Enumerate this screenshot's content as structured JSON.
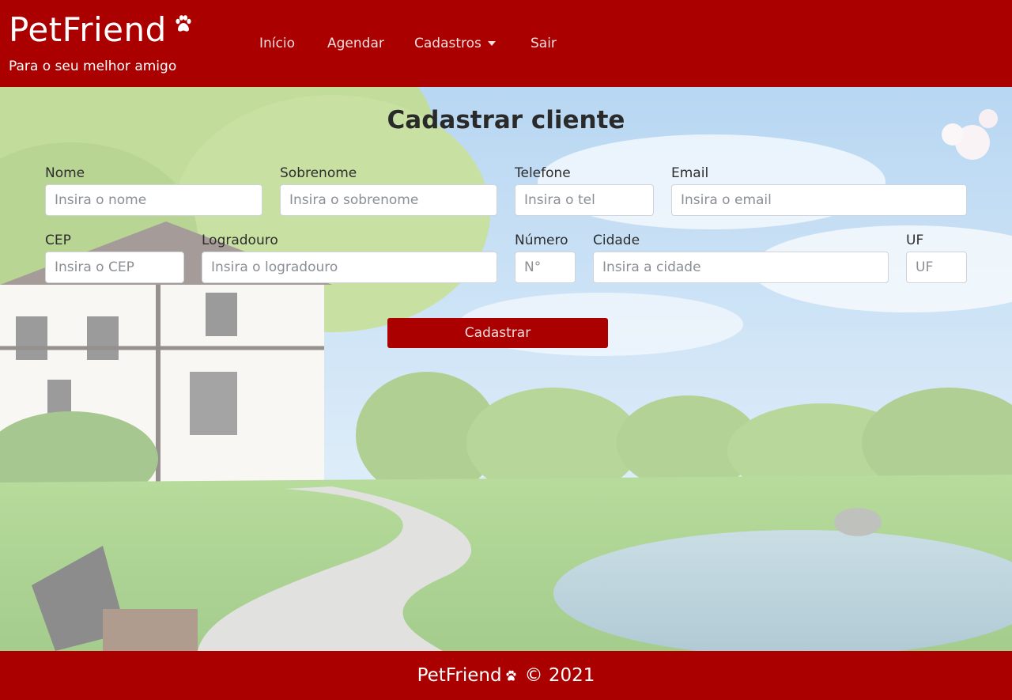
{
  "header": {
    "brand": "PetFriend",
    "tagline": "Para o seu melhor amigo",
    "nav": [
      {
        "label": "Início"
      },
      {
        "label": "Agendar"
      },
      {
        "label": "Cadastros",
        "dropdown": true
      },
      {
        "label": "Sair"
      }
    ]
  },
  "form": {
    "title": "Cadastrar cliente",
    "fields": {
      "nome": {
        "label": "Nome",
        "placeholder": "Insira o nome",
        "value": ""
      },
      "sobrenome": {
        "label": "Sobrenome",
        "placeholder": "Insira o sobrenome",
        "value": ""
      },
      "telefone": {
        "label": "Telefone",
        "placeholder": "Insira o tel",
        "value": ""
      },
      "email": {
        "label": "Email",
        "placeholder": "Insira o email",
        "value": ""
      },
      "cep": {
        "label": "CEP",
        "placeholder": "Insira o CEP",
        "value": ""
      },
      "logradouro": {
        "label": "Logradouro",
        "placeholder": "Insira o logradouro",
        "value": ""
      },
      "numero": {
        "label": "Número",
        "placeholder": "N°",
        "value": ""
      },
      "cidade": {
        "label": "Cidade",
        "placeholder": "Insira a cidade",
        "value": ""
      },
      "uf": {
        "label": "UF",
        "placeholder": "UF",
        "value": ""
      }
    },
    "submit_label": "Cadastrar"
  },
  "footer": {
    "brand": "PetFriend",
    "copyright": "© 2021"
  },
  "icons": {
    "brand": "paw-icon",
    "nav_dropdown": "caret-down-icon"
  },
  "colors": {
    "brand_red": "#ab0000",
    "nav_text": "#f5dede",
    "input_border": "#cfd4da"
  }
}
